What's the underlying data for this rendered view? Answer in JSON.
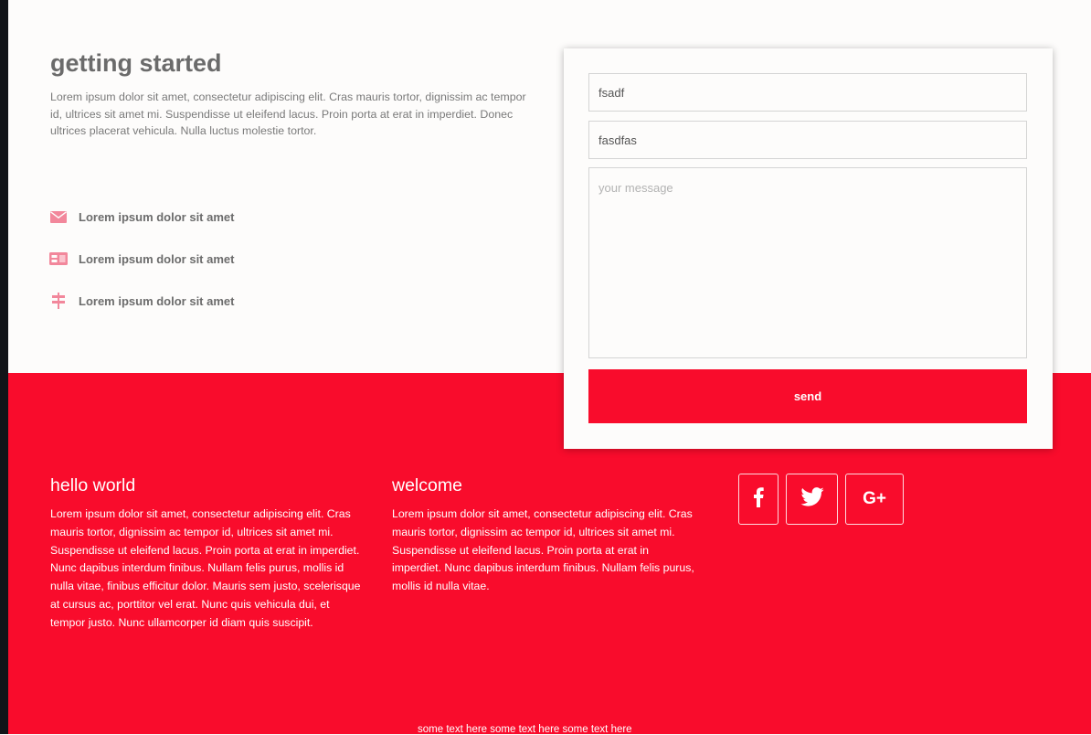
{
  "colors": {
    "accent": "#f90c2c",
    "page_bg": "#fdfcfb",
    "heading": "#6b6b6b",
    "icon": "#f2879b"
  },
  "intro": {
    "title": "getting started",
    "text": "Lorem ipsum dolor sit amet, consectetur adipiscing elit. Cras mauris tortor, dignissim ac tempor id, ultrices sit amet mi. Suspendisse ut eleifend lacus. Proin porta at erat in imperdiet. Donec ultrices placerat vehicula. Nulla luctus molestie tortor.",
    "contacts": [
      {
        "icon": "mail-icon",
        "label": "Lorem ipsum dolor sit amet"
      },
      {
        "icon": "id-card-icon",
        "label": "Lorem ipsum dolor sit amet"
      },
      {
        "icon": "signpost-icon",
        "label": "Lorem ipsum dolor sit amet"
      }
    ]
  },
  "form": {
    "field1_value": "fsadf",
    "field2_value": "fasdfas",
    "message_placeholder": "your message",
    "send_label": "send"
  },
  "footer": {
    "col1": {
      "title": "hello world",
      "text": "Lorem ipsum dolor sit amet, consectetur adipiscing elit. Cras mauris tortor, dignissim ac tempor id, ultrices sit amet mi. Suspendisse ut eleifend lacus. Proin porta at erat in imperdiet. Nunc dapibus interdum finibus. Nullam felis purus, mollis id nulla vitae, finibus efficitur dolor. Mauris sem justo, scelerisque at cursus ac, porttitor vel erat. Nunc quis vehicula dui, et tempor justo. Nunc ullamcorper id diam quis suscipit."
    },
    "col2": {
      "title": "welcome",
      "text": "Lorem ipsum dolor sit amet, consectetur adipiscing elit. Cras mauris tortor, dignissim ac tempor id, ultrices sit amet mi. Suspendisse ut eleifend lacus. Proin porta at erat in imperdiet. Nunc dapibus interdum finibus. Nullam felis purus, mollis id nulla vitae."
    },
    "social": [
      {
        "icon": "facebook-icon"
      },
      {
        "icon": "twitter-icon"
      },
      {
        "icon": "google-plus-icon",
        "label": "G+"
      }
    ],
    "bottom_text": "some text here some text here some text here"
  }
}
